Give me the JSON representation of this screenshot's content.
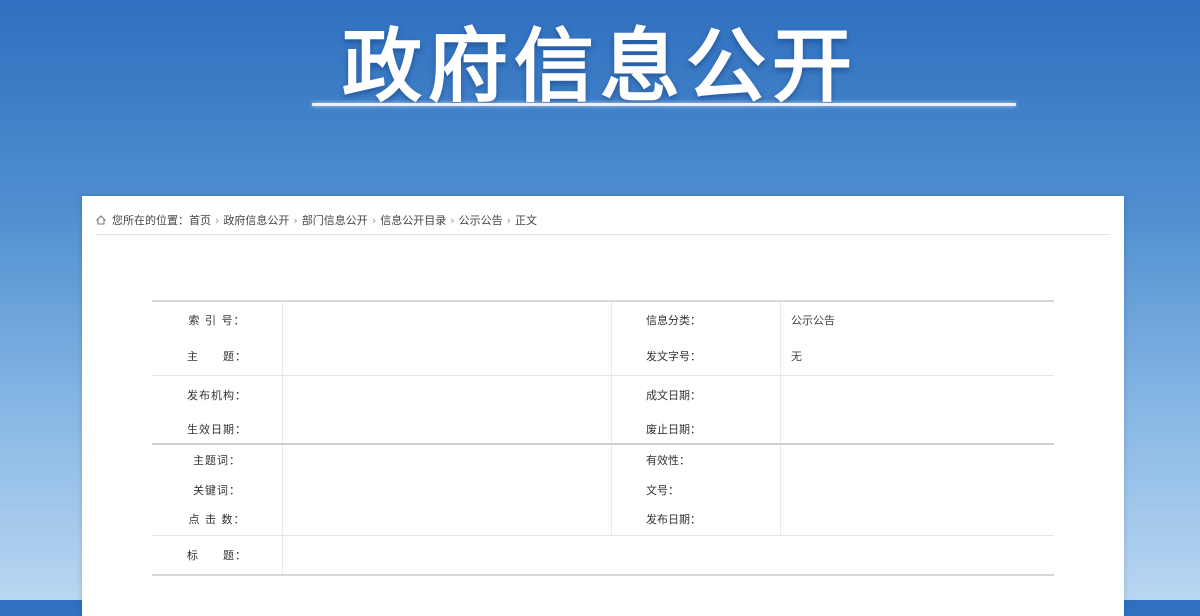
{
  "banner": {
    "title": "政府信息公开"
  },
  "breadcrumb": {
    "items": [
      "您所在的位置：首页",
      "政府信息公开",
      "部门信息公开",
      "信息公开目录",
      "公示公告",
      "正文"
    ]
  },
  "info": {
    "index_no_label": "索 引 号：",
    "index_no": "",
    "category_label": "信息分类：",
    "category": "公示公告",
    "subject_label": "主　　题：",
    "subject": "",
    "doc_no_label": "发文字号：",
    "doc_no": "无",
    "publisher_label": "发布机构：",
    "publisher": "",
    "written_date_label": "成文日期：",
    "written_date": "",
    "effective_date_label": "生效日期：",
    "effective_date": "",
    "expiry_date_label": "废止日期：",
    "expiry_date": "",
    "theme_words_label": "主题词：",
    "theme_words": "",
    "validity_label": "有效性：",
    "validity": "",
    "keywords_label": "关键词：",
    "keywords": "",
    "issue_no_label": "文号：",
    "issue_no": "",
    "hit_label": "点 击 数：",
    "hit": "",
    "pub_date_label": "发布日期：",
    "pub_date": "",
    "title_label": "标　　题：",
    "title": ""
  },
  "colors": {
    "banner_top": "#2f6fbf",
    "banner_bottom": "#b9d6f1"
  }
}
